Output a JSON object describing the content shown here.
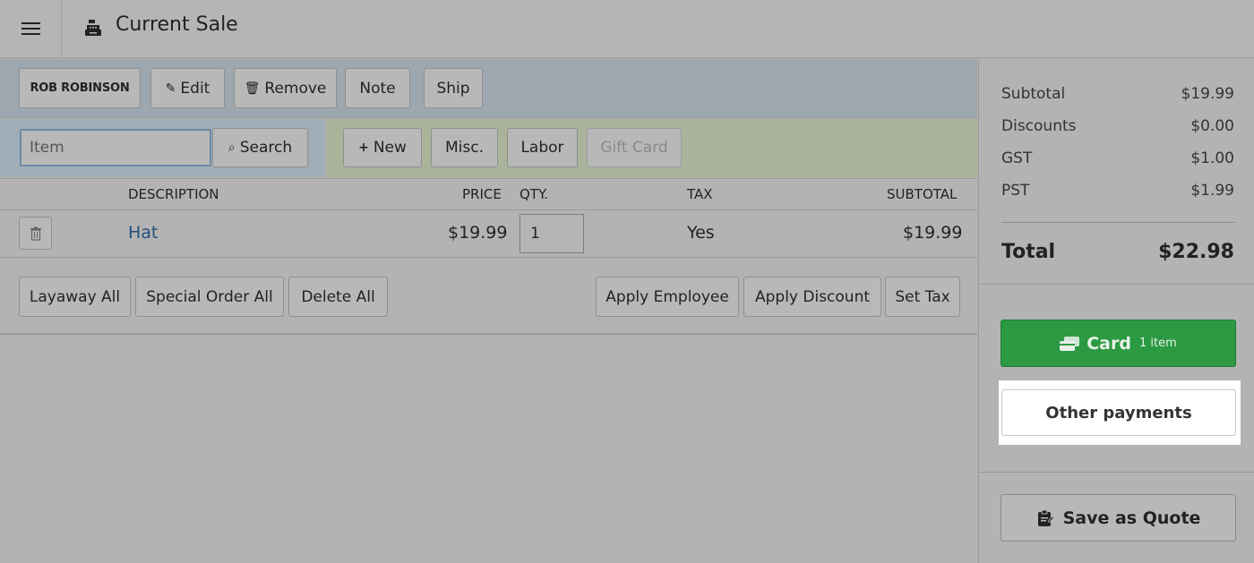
{
  "header": {
    "title": "Current Sale",
    "menu_icon": "hamburger-menu-icon",
    "register_icon": "cash-register-icon"
  },
  "customer_bar": {
    "customer_name": "ROB ROBINSON",
    "edit_label": "Edit",
    "remove_label": "Remove",
    "note_label": "Note",
    "ship_label": "Ship"
  },
  "search": {
    "placeholder": "Item",
    "button_label": "Search"
  },
  "item_buttons": {
    "new_label": "New",
    "misc_label": "Misc.",
    "labor_label": "Labor",
    "gift_card_label": "Gift Card"
  },
  "table": {
    "headers": {
      "description": "DESCRIPTION",
      "price": "PRICE",
      "qty": "QTY.",
      "tax": "TAX",
      "subtotal": "SUBTOTAL"
    },
    "rows": [
      {
        "description": "Hat",
        "price": "$19.99",
        "qty": "1",
        "tax": "Yes",
        "subtotal": "$19.99"
      }
    ]
  },
  "actions": {
    "layaway_all": "Layaway All",
    "special_order_all": "Special Order All",
    "delete_all": "Delete All",
    "apply_employee": "Apply Employee",
    "apply_discount": "Apply Discount",
    "set_tax": "Set Tax"
  },
  "summary": {
    "subtotal_label": "Subtotal",
    "subtotal_value": "$19.99",
    "discounts_label": "Discounts",
    "discounts_value": "$0.00",
    "gst_label": "GST",
    "gst_value": "$1.00",
    "pst_label": "PST",
    "pst_value": "$1.99",
    "total_label": "Total",
    "total_value": "$22.98"
  },
  "payment": {
    "card_label": "Card",
    "card_count": "1 item",
    "other_payments_label": "Other payments",
    "save_quote_label": "Save as Quote"
  },
  "colors": {
    "card_green": "#2b9a42",
    "link_blue": "#234f7c",
    "highlight": "#ffffff"
  }
}
